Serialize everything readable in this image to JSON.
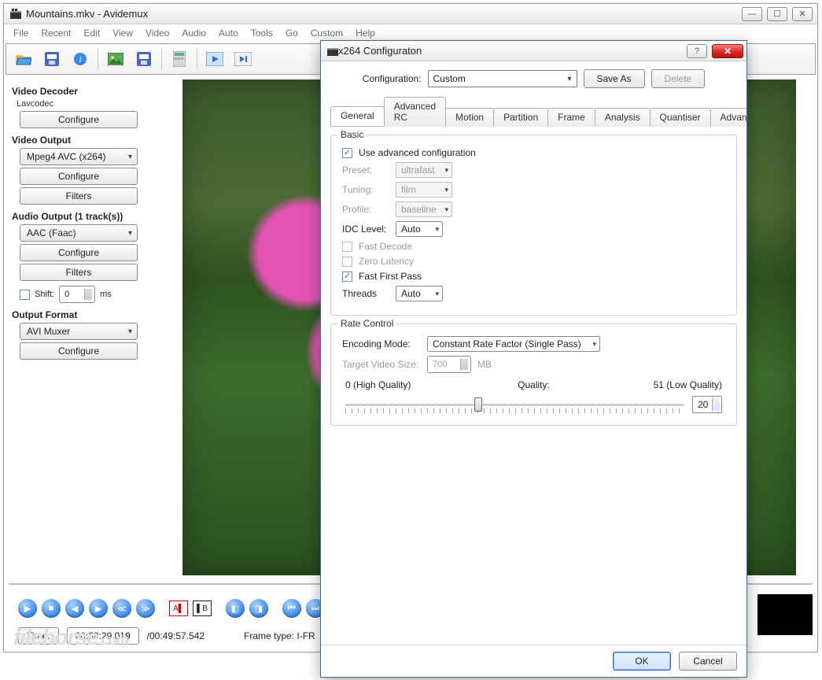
{
  "main": {
    "title": "Mountains.mkv - Avidemux",
    "menu": [
      "File",
      "Recent",
      "Edit",
      "View",
      "Video",
      "Audio",
      "Auto",
      "Tools",
      "Go",
      "Custom",
      "Help"
    ],
    "decoder": {
      "title": "Video Decoder",
      "codec": "Lavcodec",
      "configure": "Configure"
    },
    "vout": {
      "title": "Video Output",
      "codec": "Mpeg4 AVC (x264)",
      "configure": "Configure",
      "filters": "Filters"
    },
    "aout": {
      "title_full": "Audio Output (1 track(s))",
      "codec": "AAC (Faac)",
      "configure": "Configure",
      "filters": "Filters",
      "shift_label": "Shift:",
      "shift_value": "0",
      "shift_unit": "ms"
    },
    "ofmt": {
      "title": "Output Format",
      "muxer": "AVI Muxer",
      "configure": "Configure"
    },
    "time_btn": "Time:",
    "time_cur": "00:38:29.019",
    "time_total": "/00:49:57.542",
    "frame_type": "Frame type: I-FR",
    "watermark": "filehorse",
    "watermark_suffix": ".com"
  },
  "dialog": {
    "title": "x264 Configuraton",
    "config_label": "Configuration:",
    "config_value": "Custom",
    "saveas": "Save As",
    "delete": "Delete",
    "tabs": [
      "General",
      "Advanced RC",
      "Motion",
      "Partition",
      "Frame",
      "Analysis",
      "Quantiser",
      "Advanced"
    ],
    "basic": {
      "legend": "Basic",
      "use_adv": "Use advanced configuration",
      "preset_lbl": "Preset:",
      "preset_val": "ultrafast",
      "tuning_lbl": "Tuning:",
      "tuning_val": "film",
      "profile_lbl": "Profile:",
      "profile_val": "baseline",
      "idc_lbl": "IDC Level:",
      "idc_val": "Auto",
      "fast_decode": "Fast Decode",
      "zero_latency": "Zero Latency",
      "fast_first": "Fast First Pass",
      "threads_lbl": "Threads",
      "threads_val": "Auto"
    },
    "rate": {
      "legend": "Rate Control",
      "mode_lbl": "Encoding Mode:",
      "mode_val": "Constant Rate Factor (Single Pass)",
      "target_lbl": "Target Video Size:",
      "target_val": "700",
      "target_unit": "MB",
      "hq": "0 (High Quality)",
      "qlabel": "Quality:",
      "lq": "51 (Low Quality)",
      "qval": "20"
    },
    "ok": "OK",
    "cancel": "Cancel"
  }
}
